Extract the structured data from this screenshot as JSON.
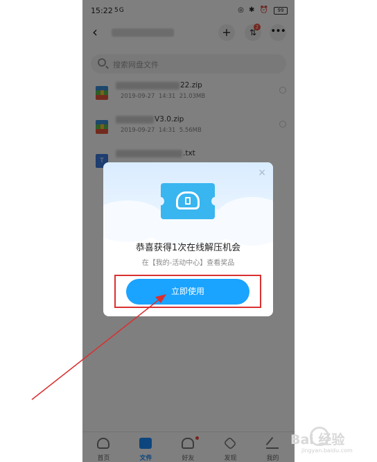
{
  "status_bar": {
    "time": "15:22",
    "network": "5G",
    "battery": "99"
  },
  "header": {
    "transfer_badge": "2"
  },
  "search": {
    "placeholder": "搜索网盘文件"
  },
  "files": [
    {
      "name_visible": "22.zip",
      "date": "2019-09-27",
      "time": "14:31",
      "size": "21.03MB",
      "type": "zip"
    },
    {
      "name_visible": "V3.0.zip",
      "date": "2019-09-27",
      "time": "14:31",
      "size": "5.56MB",
      "type": "zip"
    },
    {
      "name_visible": ".txt",
      "type": "txt"
    }
  ],
  "dialog": {
    "title": "恭喜获得1次在线解压机会",
    "subtitle": "在【我的-活动中心】查看奖品",
    "button_label": "立即使用",
    "close_symbol": "×"
  },
  "tabbar": {
    "items": [
      {
        "label": "首页",
        "icon": "cloud-icon"
      },
      {
        "label": "文件",
        "icon": "folder-icon",
        "active": true
      },
      {
        "label": "好友",
        "icon": "person-icon"
      },
      {
        "label": "发现",
        "icon": "discover-icon"
      },
      {
        "label": "我的",
        "icon": "profile-icon"
      }
    ]
  },
  "watermark": {
    "text": "Bai 经验",
    "url": "jingyan.baidu.com"
  },
  "colors": {
    "accent": "#1aa3ff",
    "annotation_red": "#d93030",
    "overlay": "rgba(0,0,0,0.5)"
  }
}
